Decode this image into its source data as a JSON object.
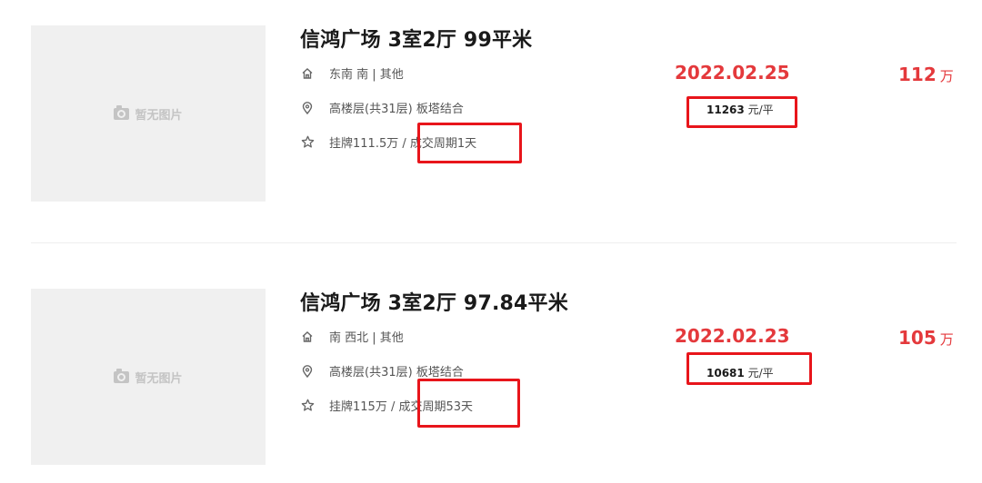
{
  "listings": [
    {
      "no_image_text": "暂无图片",
      "title": "信鸿广场 3室2厅 99平米",
      "orientation": "东南 南 | 其他",
      "floor": "高楼层(共31层) 板塔结合",
      "listing_info": "挂牌111.5万 / 成交周期1天",
      "deal_date": "2022.02.25",
      "unit_price_value": "11263",
      "unit_price_unit": "元/平",
      "total_price": "112",
      "total_price_unit": "万"
    },
    {
      "no_image_text": "暂无图片",
      "title": "信鸿广场 3室2厅 97.84平米",
      "orientation": "南 西北 | 其他",
      "floor": "高楼层(共31层) 板塔结合",
      "listing_info": "挂牌115万 / 成交周期53天",
      "deal_date": "2022.02.23",
      "unit_price_value": "10681",
      "unit_price_unit": "元/平",
      "total_price": "105",
      "total_price_unit": "万"
    }
  ],
  "colors": {
    "accent_red": "#e4393c",
    "highlight_box": "#e8151b",
    "placeholder_bg": "#f0f0f0"
  },
  "icons": [
    "camera-icon",
    "house-icon",
    "location-pin-icon",
    "star-icon"
  ]
}
